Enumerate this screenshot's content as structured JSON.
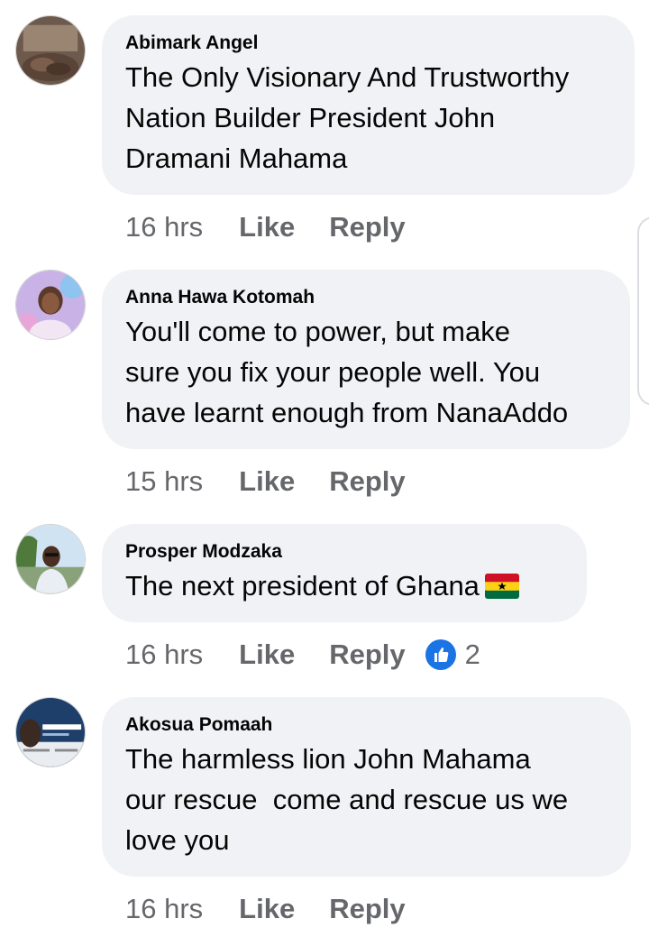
{
  "comments": [
    {
      "author": "Abimark Angel",
      "text_lines": [
        "The Only Visionary And Trustworthy",
        "Nation Builder President John",
        "Dramani Mahama"
      ],
      "time": "16 hrs",
      "like_label": "Like",
      "reply_label": "Reply"
    },
    {
      "author": "Anna Hawa Kotomah",
      "text_lines": [
        "You'll come to power, but make",
        "sure you fix your people well. You",
        "have learnt enough from NanaAddo"
      ],
      "time": "15 hrs",
      "like_label": "Like",
      "reply_label": "Reply"
    },
    {
      "author": "Prosper Modzaka",
      "text_lines": [
        "The next president of Ghana"
      ],
      "emoji": "ghana-flag",
      "time": "16 hrs",
      "like_label": "Like",
      "reply_label": "Reply",
      "reaction_count": "2"
    },
    {
      "author": "Akosua Pomaah",
      "text_lines": [
        "The harmless lion John Mahama",
        "our rescue  come and rescue us we",
        "love you"
      ],
      "time": "16 hrs",
      "like_label": "Like",
      "reply_label": "Reply"
    }
  ],
  "colors": {
    "bubble": "#f0f2f5",
    "meta_text": "#65676b",
    "like_blue": "#1b74e4",
    "flag_red": "#ce1126",
    "flag_gold": "#fcd116",
    "flag_green": "#006b3f"
  }
}
